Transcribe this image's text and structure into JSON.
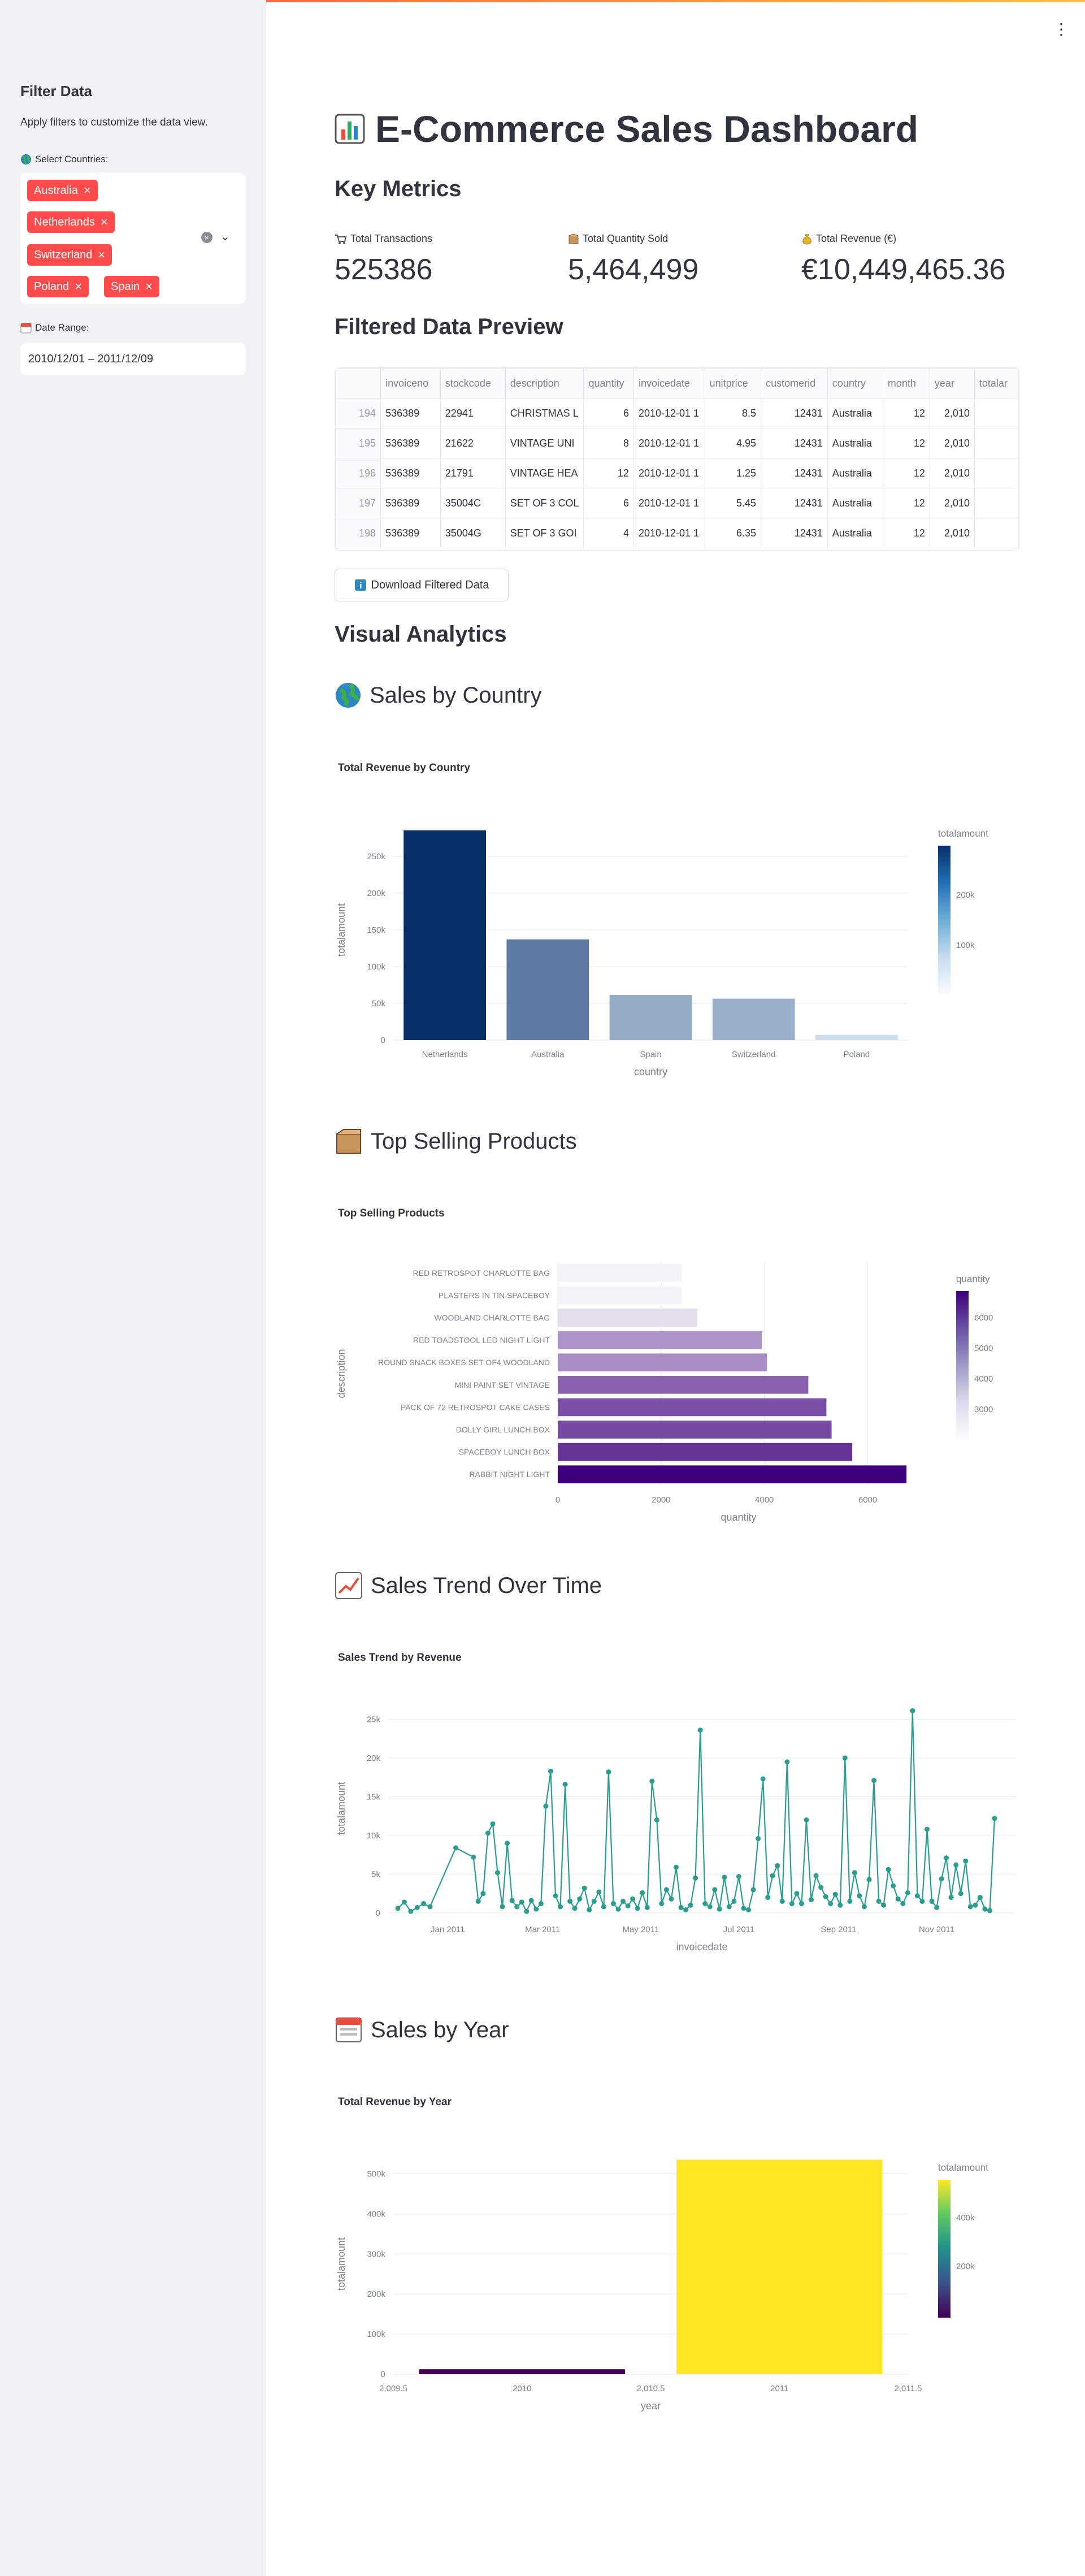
{
  "sidebar": {
    "title": "Filter Data",
    "subtitle": "Apply filters to customize the data view.",
    "countries_label": "Select Countries:",
    "selected_countries": [
      "Australia",
      "Netherlands",
      "Switzerland",
      "Poland",
      "Spain"
    ],
    "tag_remove": "×",
    "clear_symbol": "×",
    "caret": "⌄",
    "date_label": "Date Range:",
    "date_value": "2010/12/01 – 2011/12/09"
  },
  "header": {
    "menu": "⋮"
  },
  "main": {
    "title": "E-Commerce Sales Dashboard",
    "key_metrics": "Key Metrics",
    "metrics": [
      {
        "label": "Total Transactions",
        "value": "525386",
        "icon": "cart-icon"
      },
      {
        "label": "Total Quantity Sold",
        "value": "5,464,499",
        "icon": "package-icon"
      },
      {
        "label": "Total Revenue (€)",
        "value": "€10,449,465.36",
        "icon": "money-bag-icon"
      }
    ],
    "preview_title": "Filtered Data Preview",
    "table": {
      "columns": [
        "",
        "invoiceno",
        "stockcode",
        "description",
        "quantity",
        "invoicedate",
        "unitprice",
        "customerid",
        "country",
        "month",
        "year",
        "totalar"
      ],
      "rows": [
        [
          "194",
          "536389",
          "22941",
          "CHRISTMAS L",
          "6",
          "2010-12-01 1",
          "8.5",
          "12431",
          "Australia",
          "12",
          "2,010",
          ""
        ],
        [
          "195",
          "536389",
          "21622",
          "VINTAGE UNI",
          "8",
          "2010-12-01 1",
          "4.95",
          "12431",
          "Australia",
          "12",
          "2,010",
          ""
        ],
        [
          "196",
          "536389",
          "21791",
          "VINTAGE HEA",
          "12",
          "2010-12-01 1",
          "1.25",
          "12431",
          "Australia",
          "12",
          "2,010",
          ""
        ],
        [
          "197",
          "536389",
          "35004C",
          "SET OF 3 COL",
          "6",
          "2010-12-01 1",
          "5.45",
          "12431",
          "Australia",
          "12",
          "2,010",
          ""
        ],
        [
          "198",
          "536389",
          "35004G",
          "SET OF 3 GOI",
          "4",
          "2010-12-01 1",
          "6.35",
          "12431",
          "Australia",
          "12",
          "2,010",
          ""
        ]
      ]
    },
    "download_label": "Download Filtered Data",
    "visual_title": "Visual Analytics",
    "sections": {
      "country": "Sales by Country",
      "products": "Top Selling Products",
      "trend": "Sales Trend Over Time",
      "year": "Sales by Year"
    }
  },
  "colors": {
    "accent": "#ff4b4b",
    "teal": "#2a9d8f",
    "blue_dark": "#08306b",
    "purple_dark": "#3f007d",
    "yellow": "#fde725"
  },
  "chart_data": [
    {
      "type": "bar",
      "title": "Total Revenue by Country",
      "xlabel": "country",
      "ylabel": "totalamount",
      "categories": [
        "Netherlands",
        "Australia",
        "Spain",
        "Switzerland",
        "Poland"
      ],
      "values": [
        285446,
        137078,
        61559,
        56444,
        7213
      ],
      "ylim": [
        0,
        300000
      ],
      "yticks": [
        0,
        50000,
        100000,
        150000,
        200000,
        250000
      ],
      "ytick_labels": [
        "0",
        "50k",
        "100k",
        "150k",
        "200k",
        "250k"
      ],
      "colorbar": {
        "title": "totalamount",
        "ticks": [
          "200k",
          "100k"
        ],
        "scale": "Blues"
      }
    },
    {
      "type": "bar",
      "orientation": "horizontal",
      "title": "Top Selling Products",
      "xlabel": "quantity",
      "ylabel": "description",
      "categories": [
        "RED RETROSPOT CHARLOTTE BAG",
        "PLASTERS IN TIN SPACEBOY",
        "WOODLAND CHARLOTTE BAG",
        "RED TOADSTOOL LED NIGHT LIGHT",
        "ROUND SNACK BOXES SET OF4 WOODLAND",
        "MINI PAINT SET VINTAGE",
        "PACK OF 72 RETROSPOT CAKE CASES",
        "DOLLY GIRL LUNCH BOX",
        "SPACEBOY LUNCH BOX",
        "RABBIT NIGHT LIGHT"
      ],
      "values": [
        2400,
        2400,
        2700,
        3950,
        4050,
        4850,
        5200,
        5300,
        5700,
        6750
      ],
      "xlim": [
        0,
        7000
      ],
      "xticks": [
        0,
        2000,
        4000,
        6000
      ],
      "colorbar": {
        "title": "quantity",
        "ticks": [
          "6000",
          "5000",
          "4000",
          "3000"
        ],
        "scale": "Purples"
      }
    },
    {
      "type": "line",
      "title": "Sales Trend by Revenue",
      "xlabel": "invoicedate",
      "ylabel": "totalamount",
      "xticks": [
        "Jan 2011",
        "Mar 2011",
        "May 2011",
        "Jul 2011",
        "Sep 2011",
        "Nov 2011"
      ],
      "ylim": [
        0,
        27000
      ],
      "ytick_labels": [
        "0",
        "5k",
        "10k",
        "15k",
        "20k",
        "25k"
      ],
      "x": [
        "2010-12-01",
        "2010-12-05",
        "2010-12-09",
        "2010-12-13",
        "2010-12-17",
        "2010-12-21",
        "2011-01-06",
        "2011-01-17",
        "2011-01-20",
        "2011-01-23",
        "2011-01-26",
        "2011-01-29",
        "2011-02-01",
        "2011-02-04",
        "2011-02-07",
        "2011-02-10",
        "2011-02-13",
        "2011-02-16",
        "2011-02-19",
        "2011-02-22",
        "2011-02-25",
        "2011-02-28",
        "2011-03-03",
        "2011-03-06",
        "2011-03-09",
        "2011-03-12",
        "2011-03-15",
        "2011-03-18",
        "2011-03-21",
        "2011-03-24",
        "2011-03-27",
        "2011-03-30",
        "2011-04-02",
        "2011-04-05",
        "2011-04-08",
        "2011-04-11",
        "2011-04-14",
        "2011-04-17",
        "2011-04-20",
        "2011-04-23",
        "2011-04-26",
        "2011-04-29",
        "2011-05-02",
        "2011-05-05",
        "2011-05-08",
        "2011-05-11",
        "2011-05-14",
        "2011-05-17",
        "2011-05-20",
        "2011-05-23",
        "2011-05-26",
        "2011-05-29",
        "2011-06-01",
        "2011-06-04",
        "2011-06-07",
        "2011-06-10",
        "2011-06-13",
        "2011-06-16",
        "2011-06-19",
        "2011-06-22",
        "2011-06-25",
        "2011-06-28",
        "2011-07-01",
        "2011-07-04",
        "2011-07-07",
        "2011-07-10",
        "2011-07-13",
        "2011-07-16",
        "2011-07-19",
        "2011-07-22",
        "2011-07-25",
        "2011-07-28",
        "2011-07-31",
        "2011-08-03",
        "2011-08-06",
        "2011-08-09",
        "2011-08-12",
        "2011-08-15",
        "2011-08-18",
        "2011-08-21",
        "2011-08-24",
        "2011-08-27",
        "2011-08-30",
        "2011-09-02",
        "2011-09-05",
        "2011-09-08",
        "2011-09-11",
        "2011-09-14",
        "2011-09-17",
        "2011-09-20",
        "2011-09-23",
        "2011-09-26",
        "2011-09-29",
        "2011-10-02",
        "2011-10-05",
        "2011-10-08",
        "2011-10-11",
        "2011-10-14",
        "2011-10-17",
        "2011-10-20",
        "2011-10-23",
        "2011-10-26",
        "2011-10-29",
        "2011-11-01",
        "2011-11-04",
        "2011-11-07",
        "2011-11-10",
        "2011-11-13",
        "2011-11-16",
        "2011-11-19",
        "2011-11-22",
        "2011-11-25",
        "2011-11-28",
        "2011-12-01",
        "2011-12-04",
        "2011-12-07"
      ],
      "values": [
        600,
        1400,
        200,
        700,
        1200,
        800,
        8400,
        7200,
        1500,
        2500,
        10300,
        11500,
        5200,
        800,
        9000,
        1600,
        800,
        1400,
        200,
        1600,
        500,
        1200,
        13800,
        18300,
        2200,
        800,
        16600,
        1500,
        600,
        1800,
        3200,
        400,
        1500,
        2700,
        800,
        18200,
        1200,
        500,
        1500,
        900,
        1800,
        600,
        2600,
        700,
        17000,
        12000,
        1200,
        3000,
        1800,
        5900,
        700,
        400,
        1000,
        4500,
        23600,
        1200,
        800,
        3000,
        500,
        4600,
        800,
        1500,
        4700,
        600,
        400,
        3000,
        9600,
        17300,
        2000,
        4800,
        6100,
        1500,
        19500,
        1200,
        2500,
        1200,
        12000,
        1700,
        4800,
        3300,
        2100,
        1200,
        2400,
        1000,
        20000,
        1500,
        5200,
        2200,
        800,
        4300,
        17100,
        1500,
        1000,
        5600,
        3500,
        1800,
        1200,
        2600,
        26100,
        2200,
        1500,
        10800,
        1500,
        700,
        4400,
        7100,
        2000,
        6200,
        2500,
        6700,
        800,
        1000,
        2000,
        500,
        300,
        12200
      ]
    },
    {
      "type": "bar",
      "title": "Total Revenue by Year",
      "xlabel": "year",
      "ylabel": "totalamount",
      "x": [
        2010,
        2011
      ],
      "values": [
        12400,
        535000
      ],
      "xlim": [
        2009.5,
        2011.5
      ],
      "xtick_labels": [
        "2,009.5",
        "2010",
        "2,010.5",
        "2011",
        "2,011.5"
      ],
      "ylim": [
        0,
        550000
      ],
      "ytick_labels": [
        "0",
        "100k",
        "200k",
        "300k",
        "400k",
        "500k"
      ],
      "colorbar": {
        "title": "totalamount",
        "ticks": [
          "400k",
          "200k"
        ],
        "scale": "Viridis"
      }
    }
  ]
}
